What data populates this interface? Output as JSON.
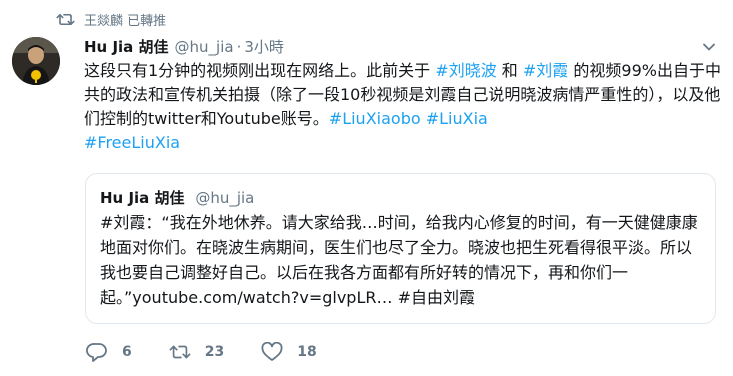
{
  "retweet": {
    "text": "王燚麟 已轉推"
  },
  "tweet": {
    "name": "Hu Jia 胡佳",
    "handle": "@hu_jia",
    "dot": "·",
    "time": "3小時",
    "body": {
      "p1": "这段只有1分钟的视频刚出现在网络上。此前关于 ",
      "tag1": "#刘晓波",
      "p2": " 和 ",
      "tag2": "#刘霞",
      "p3": " 的视频99%出自于中共的政法和宣传机关拍摄（除了一段10秒视频是刘霞自己说明晓波病情严重性的），以及他们控制的twitter和Youtube账号。",
      "tag3": "#LiuXiaobo",
      "p4": " ",
      "tag4": "#LiuXia",
      "tag5": "#FreeLiuXia"
    }
  },
  "quote": {
    "name": "Hu Jia 胡佳",
    "handle": "@hu_jia",
    "text": "#刘霞：“我在外地休养。请大家给我…时间，给我内心修复的时间，有一天健健康康地面对你们。在晓波生病期间，医生们也尽了全力。晓波也把生死看得很平淡。所以我也要自己调整好自己。以后在我各方面都有所好转的情况下，再和你们一起。”youtube.com/watch?v=glvpLR… #自由刘霞"
  },
  "actions": {
    "replies": "6",
    "retweets": "23",
    "likes": "18"
  },
  "icons": {
    "retweet_bar": "retweet-icon",
    "chevron": "chevron-down-icon",
    "reply": "reply-icon",
    "retweet": "retweet-icon",
    "like": "heart-icon"
  },
  "colors": {
    "link": "#1da1f2",
    "muted": "#657786",
    "text": "#14171a",
    "border": "#e1e8ed"
  }
}
